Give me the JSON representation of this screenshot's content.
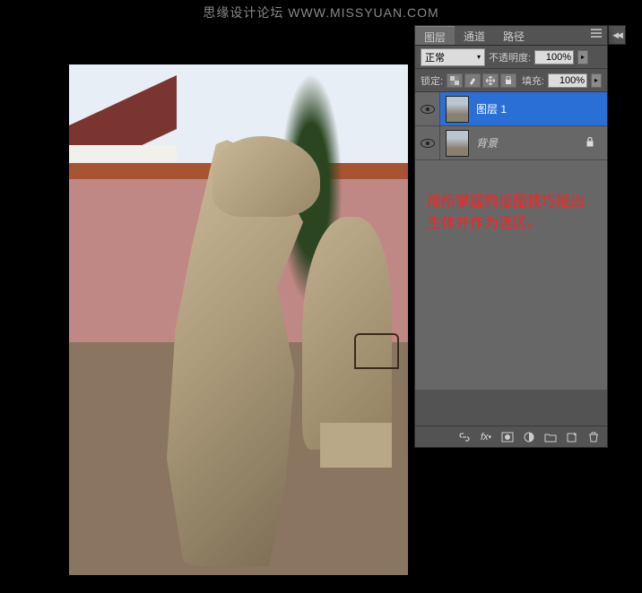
{
  "watermark": "思缘设计论坛  WWW.MISSYUAN.COM",
  "panel": {
    "tabs": {
      "layers": "图层",
      "channels": "通道",
      "paths": "路径"
    },
    "blend_mode": {
      "selected": "正常"
    },
    "opacity_label": "不透明度:",
    "opacity_value": "100%",
    "lock_label": "锁定:",
    "fill_label": "填充:",
    "fill_value": "100%",
    "layers": [
      {
        "name": "图层 1",
        "selected": true,
        "locked": false
      },
      {
        "name": "背景",
        "selected": false,
        "locked": true
      }
    ]
  },
  "annotation": {
    "line1": "用所掌握的抠图技巧抠出",
    "line2": "主体并作为选区。"
  },
  "icons": {
    "menu": "menu-icon",
    "eye": "eye-icon",
    "lock": "lock-icon",
    "link": "link-icon",
    "fx": "fx",
    "mask": "mask-icon",
    "adjust": "adjust-icon",
    "folder": "folder-icon",
    "new": "new-layer-icon",
    "trash": "trash-icon"
  }
}
